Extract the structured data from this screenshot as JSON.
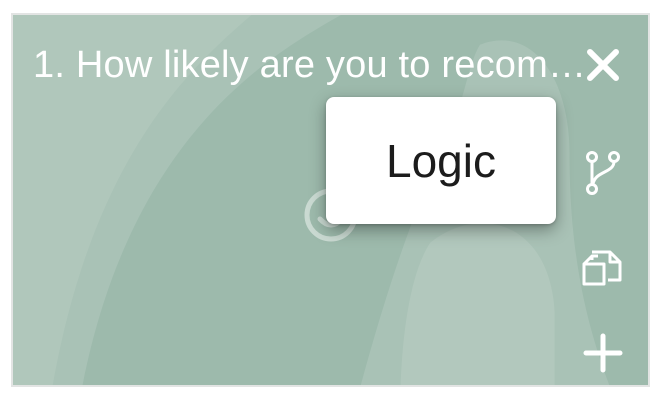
{
  "question": {
    "title": "1. How likely are you to recom…"
  },
  "toolbar": {
    "close_icon": "close-icon",
    "logic_icon": "branch-icon",
    "duplicate_icon": "duplicate-icon",
    "add_icon": "plus-icon"
  },
  "tooltip": {
    "text": "Logic"
  },
  "colors": {
    "card_background": "#9dbaac",
    "card_light_shape": "#b3c9bf",
    "card_dark_shape": "#8eae9f",
    "icon": "#ffffff",
    "tooltip_background": "#ffffff",
    "tooltip_text": "#1c1c1c"
  }
}
